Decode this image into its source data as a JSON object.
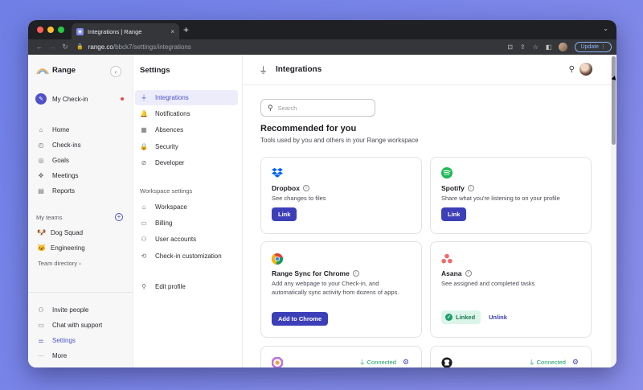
{
  "browser": {
    "tab_title": "Integrations | Range",
    "tab_close": "×",
    "new_tab": "+",
    "url_host": "range.co",
    "url_path": "/bbck7/settings/integrations",
    "update_label": "Update",
    "traffic_colors": [
      "#ff5f57",
      "#febc2e",
      "#28c840"
    ]
  },
  "sidebar": {
    "brand": "Range",
    "collapse_glyph": "‹",
    "my_checkin": "My Check-in",
    "nav": [
      {
        "label": "Home",
        "icon": "home-icon",
        "glyph": "⌂"
      },
      {
        "label": "Check-ins",
        "icon": "checkin-icon",
        "glyph": "◴"
      },
      {
        "label": "Goals",
        "icon": "goals-icon",
        "glyph": "◎"
      },
      {
        "label": "Meetings",
        "icon": "meetings-icon",
        "glyph": "✥"
      },
      {
        "label": "Reports",
        "icon": "reports-icon",
        "glyph": "▤"
      }
    ],
    "my_teams": "My teams",
    "teams_plus": "+",
    "teams": [
      {
        "label": "Dog Squad",
        "emoji": "🐶"
      },
      {
        "label": "Engineering",
        "emoji": "🐱"
      }
    ],
    "team_directory": "Team directory  ›",
    "bottom": [
      {
        "label": "Invite people",
        "icon": "invite-people-icon",
        "glyph": "⚇"
      },
      {
        "label": "Chat with support",
        "icon": "chat-icon",
        "glyph": "▭"
      },
      {
        "label": "Settings",
        "icon": "settings-icon",
        "glyph": "⚌"
      },
      {
        "label": "More",
        "icon": "more-icon",
        "glyph": "···"
      }
    ]
  },
  "settings": {
    "title": "Settings",
    "items": [
      {
        "label": "Integrations",
        "icon": "plug-icon",
        "glyph": "⏚"
      },
      {
        "label": "Notifications",
        "icon": "bell-icon",
        "glyph": "🔔"
      },
      {
        "label": "Absences",
        "icon": "calendar-icon",
        "glyph": "▦"
      },
      {
        "label": "Security",
        "icon": "lock-icon",
        "glyph": "🔒"
      },
      {
        "label": "Developer",
        "icon": "developer-icon",
        "glyph": "⊘"
      }
    ],
    "workspace_heading": "Workspace settings",
    "workspace_items": [
      {
        "label": "Workspace",
        "icon": "workspace-icon",
        "glyph": "⌂"
      },
      {
        "label": "Billing",
        "icon": "billing-icon",
        "glyph": "▭"
      },
      {
        "label": "User accounts",
        "icon": "users-icon",
        "glyph": "⚇"
      },
      {
        "label": "Check-in customization",
        "icon": "customization-icon",
        "glyph": "⟲"
      }
    ],
    "edit_profile": {
      "label": "Edit profile",
      "icon": "profile-icon",
      "glyph": "⚲"
    }
  },
  "main": {
    "title": "Integrations",
    "search_placeholder": "Search",
    "recommended_title": "Recommended for you",
    "recommended_sub": "Tools used by you and others in your Range workspace",
    "cards": [
      {
        "name": "Dropbox",
        "desc": "See changes to files",
        "button": "Link"
      },
      {
        "name": "Spotify",
        "desc": "Share what you're listening to on your profile",
        "button": "Link"
      },
      {
        "name": "Range Sync for Chrome",
        "desc": "Add any webpage to your Check-in, and automatically sync activity from dozens of apps.",
        "button": "Add to Chrome"
      },
      {
        "name": "Asana",
        "desc": "See assigned and completed tasks",
        "badge": "Linked",
        "unlink": "Unlink"
      }
    ],
    "connected_label": "Connected"
  },
  "colors": {
    "accent": "#4f52c9",
    "button": "#3d3fb8",
    "connected": "#1b9e67",
    "checkin_dot": "#e5484d"
  }
}
